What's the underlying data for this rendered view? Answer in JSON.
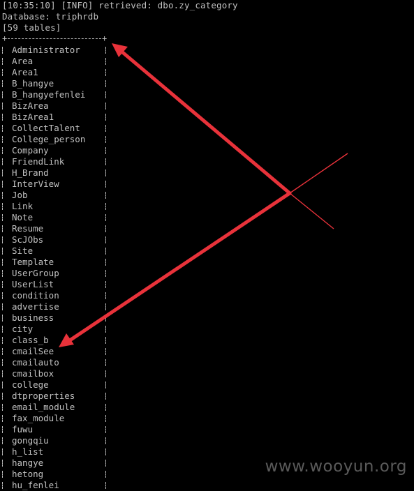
{
  "terminal": {
    "header_lines": [
      "[10:35:10] [INFO] retrieved: dbo.zy_category",
      "Database: triphrdb",
      "[59 tables]"
    ],
    "table_names": [
      "Administrator",
      "Area",
      "Area1",
      "B_hangye",
      "B_hangyefenlei",
      "BizArea",
      "BizArea1",
      "CollectTalent",
      "College_person",
      "Company",
      "FriendLink",
      "H_Brand",
      "InterView",
      "Job",
      "Link",
      "Note",
      "Resume",
      "ScJObs",
      "Site",
      "Template",
      "UserGroup",
      "UserList",
      "condition",
      "advertise",
      "business",
      "city",
      "class_b",
      "cmailSee",
      "cmailauto",
      "cmailbox",
      "college",
      "dtproperties",
      "email_module",
      "fax_module",
      "fuwu",
      "gongqiu",
      "h_list",
      "hangye",
      "hetong",
      "hu_fenlei"
    ]
  },
  "watermark": "www.wooyun.org",
  "colors": {
    "background": "#000000",
    "text": "#c0c0c0",
    "arrow": "#e8323a",
    "watermark": "#5a5a5a"
  }
}
